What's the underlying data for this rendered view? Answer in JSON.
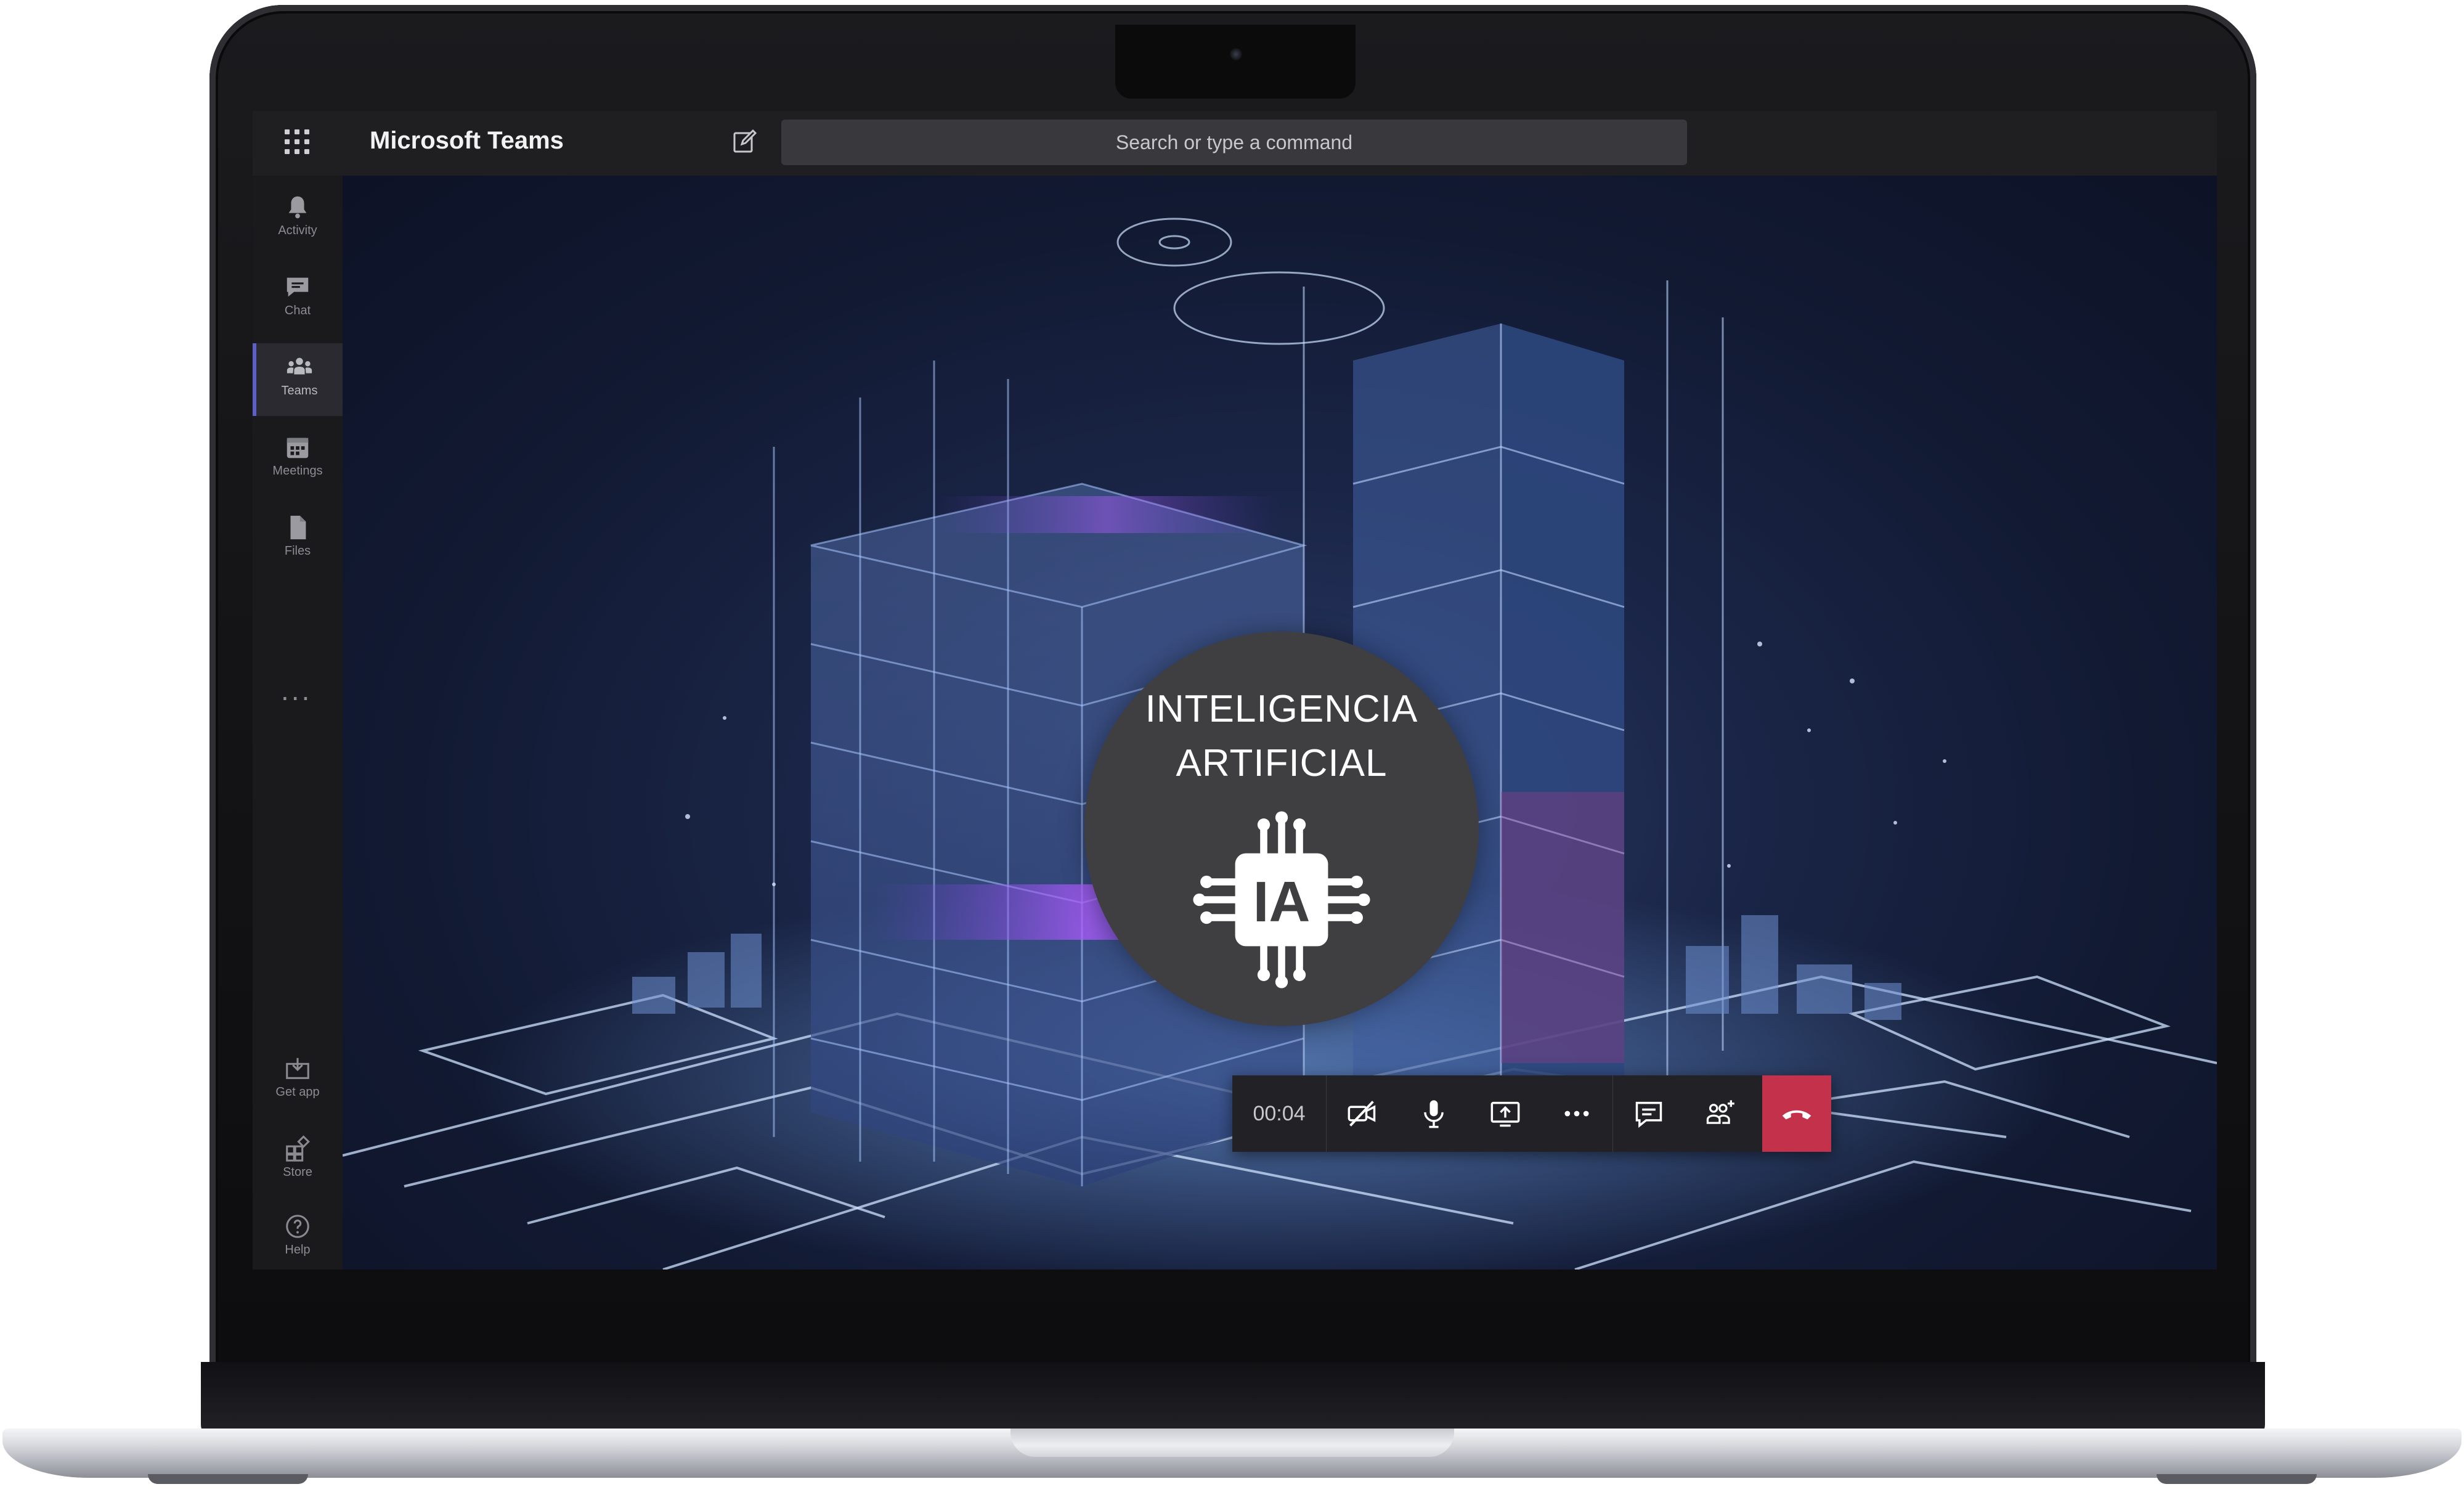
{
  "app": {
    "title": "Microsoft Teams",
    "search_placeholder": "Search or type a command"
  },
  "sidebar": {
    "items": [
      {
        "label": "Activity",
        "icon": "bell-icon"
      },
      {
        "label": "Chat",
        "icon": "chat-icon"
      },
      {
        "label": "Teams",
        "icon": "teams-icon",
        "active": true
      },
      {
        "label": "Meetings",
        "icon": "calendar-icon"
      },
      {
        "label": "Files",
        "icon": "file-icon"
      }
    ],
    "more": "...",
    "bottom_items": [
      {
        "label": "Get app",
        "icon": "download-icon"
      },
      {
        "label": "Store",
        "icon": "store-icon"
      },
      {
        "label": "Help",
        "icon": "help-icon"
      }
    ]
  },
  "call": {
    "participant_line1": "INTELIGENCIA",
    "participant_line2": "ARTIFICIAL",
    "avatar_glyph": "IA",
    "timer": "00:04",
    "hangup_color": "#c4314b"
  },
  "colors": {
    "accent": "#5b5fc7",
    "titlebar": "#1f1f22",
    "sidebar": "#1a1a1d"
  }
}
